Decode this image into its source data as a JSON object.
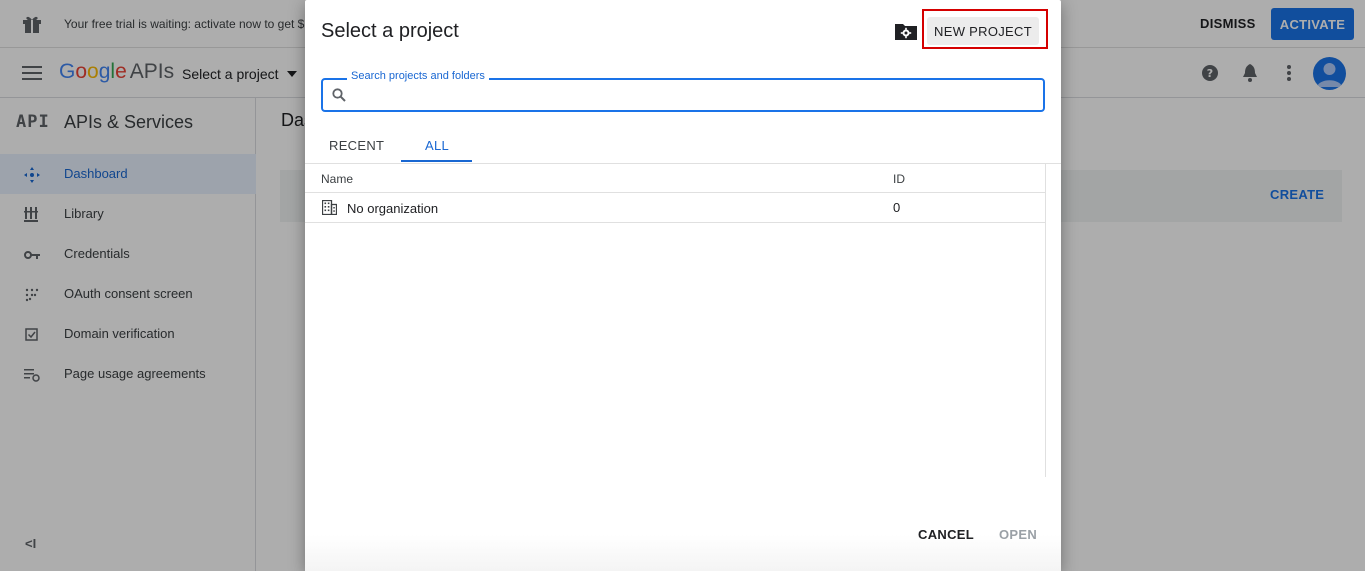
{
  "trial_bar": {
    "message": "Your free trial is waiting: activate now to get $",
    "dismiss_label": "DISMISS",
    "activate_label": "ACTIVATE"
  },
  "header": {
    "logo_google": [
      "G",
      "o",
      "o",
      "g",
      "l",
      "e"
    ],
    "logo_suffix": "APIs",
    "project_selector_label": "Select a project"
  },
  "sidebar": {
    "badge": "API",
    "title": "APIs & Services",
    "items": [
      {
        "label": "Dashboard",
        "icon": "dashboard-icon",
        "active": true
      },
      {
        "label": "Library",
        "icon": "library-icon",
        "active": false
      },
      {
        "label": "Credentials",
        "icon": "key-icon",
        "active": false
      },
      {
        "label": "OAuth consent screen",
        "icon": "consent-icon",
        "active": false
      },
      {
        "label": "Domain verification",
        "icon": "checkbox-icon",
        "active": false
      },
      {
        "label": "Page usage agreements",
        "icon": "settings-list-icon",
        "active": false
      }
    ],
    "collapse_label": "<I"
  },
  "main": {
    "page_title": "Das",
    "create_label": "CREATE"
  },
  "dialog": {
    "title": "Select a project",
    "new_project_label": "NEW PROJECT",
    "search": {
      "label": "Search projects and folders",
      "value": "",
      "placeholder": ""
    },
    "tabs": [
      {
        "label": "RECENT",
        "selected": false
      },
      {
        "label": "ALL",
        "selected": true
      }
    ],
    "table": {
      "columns": [
        "Name",
        "ID"
      ],
      "rows": [
        {
          "name": "No organization",
          "id": "0",
          "icon": "organization-icon"
        }
      ]
    },
    "cancel_label": "CANCEL",
    "open_label": "OPEN"
  },
  "colors": {
    "accent": "#1a73e8",
    "highlight_border": "#d50000"
  }
}
